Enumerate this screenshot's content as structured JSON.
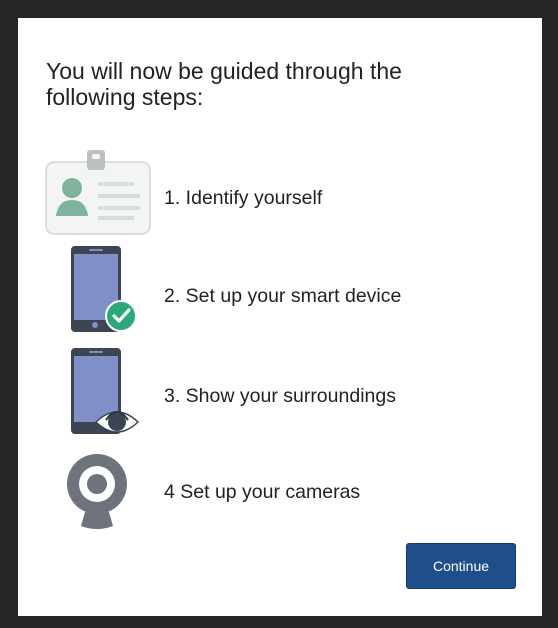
{
  "dialog": {
    "heading": "You will now be guided through the following steps:",
    "steps": [
      {
        "label": "1. Identify yourself",
        "icon": "id-card-icon"
      },
      {
        "label": "2. Set up your smart device",
        "icon": "phone-check-icon"
      },
      {
        "label": "3. Show your surroundings",
        "icon": "phone-eye-icon"
      },
      {
        "label": "4 Set up your cameras",
        "icon": "webcam-icon"
      }
    ],
    "continue_label": "Continue"
  },
  "colors": {
    "primary_button": "#1f4f8b",
    "phone_body": "#7f8fc8",
    "phone_frame": "#3d4452",
    "check_green": "#2aa87a",
    "person_green": "#7fb39d",
    "webcam_gray": "#6f737c"
  }
}
